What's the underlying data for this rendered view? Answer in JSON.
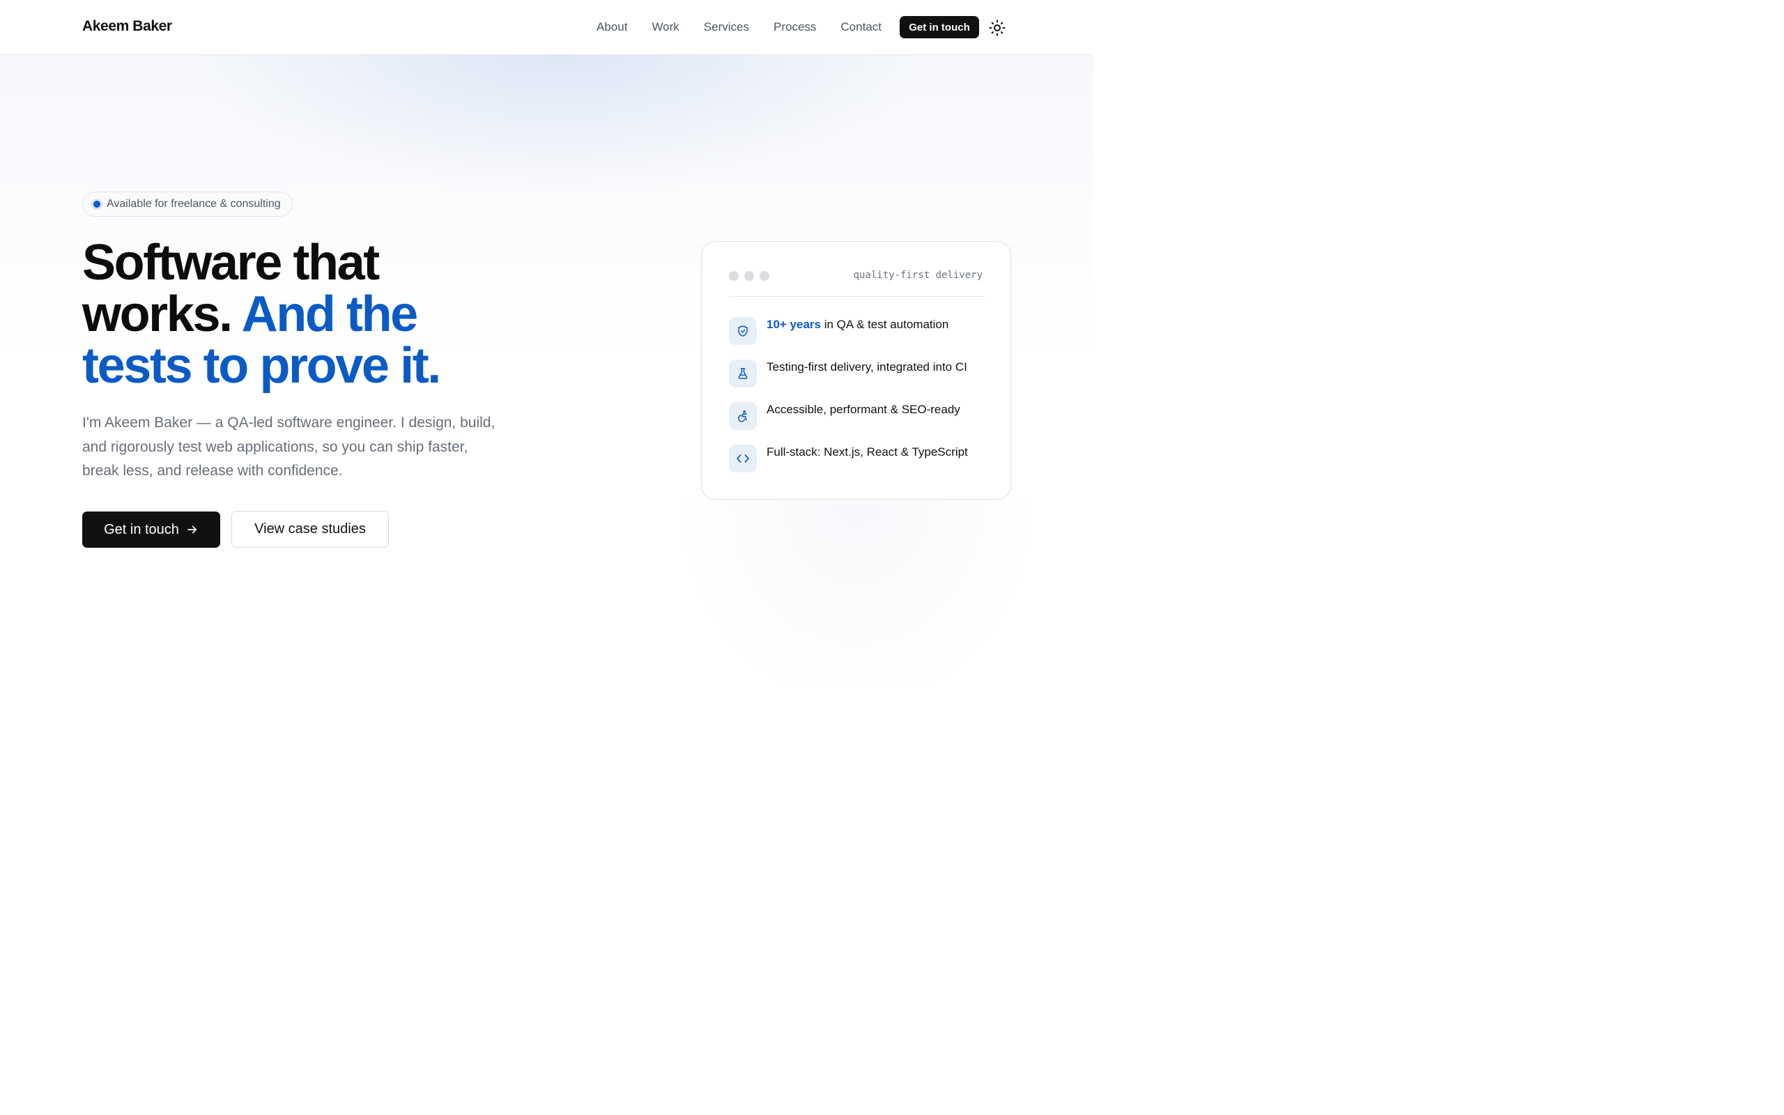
{
  "header": {
    "brand": "Akeem Baker",
    "nav": [
      "About",
      "Work",
      "Services",
      "Process",
      "Contact"
    ],
    "cta_label": "Get in touch",
    "theme_icon": "sun-icon"
  },
  "hero": {
    "badge": "Available for freelance & consulting",
    "title_line1": "Software that",
    "title_line2_plain": "works.",
    "title_line2_accent": "And the",
    "title_line3_accent": "tests to prove it.",
    "lede": "I'm Akeem Baker — a QA-led software engineer. I design, build, and rigorously test web applications, so you can ship faster, break less, and release with confidence.",
    "primary_label": "Get in touch",
    "primary_icon": "arrow-right-icon",
    "secondary_label": "View case studies"
  },
  "card": {
    "tag": "quality-first delivery",
    "features": [
      {
        "icon": "shield-check-icon",
        "highlight": "10+ years",
        "text": " in QA & test automation"
      },
      {
        "icon": "flask-icon",
        "highlight": "",
        "text": "Testing-first delivery, integrated into CI"
      },
      {
        "icon": "accessibility-icon",
        "highlight": "",
        "text": "Accessible, performant & SEO-ready"
      },
      {
        "icon": "code-icon",
        "highlight": "",
        "text": "Full-stack: Next.js, React & TypeScript"
      }
    ]
  },
  "colors": {
    "accent": "#0b5bc6",
    "ink": "#111111",
    "muted": "#676d77",
    "icon_bg": "#e8eff9"
  }
}
